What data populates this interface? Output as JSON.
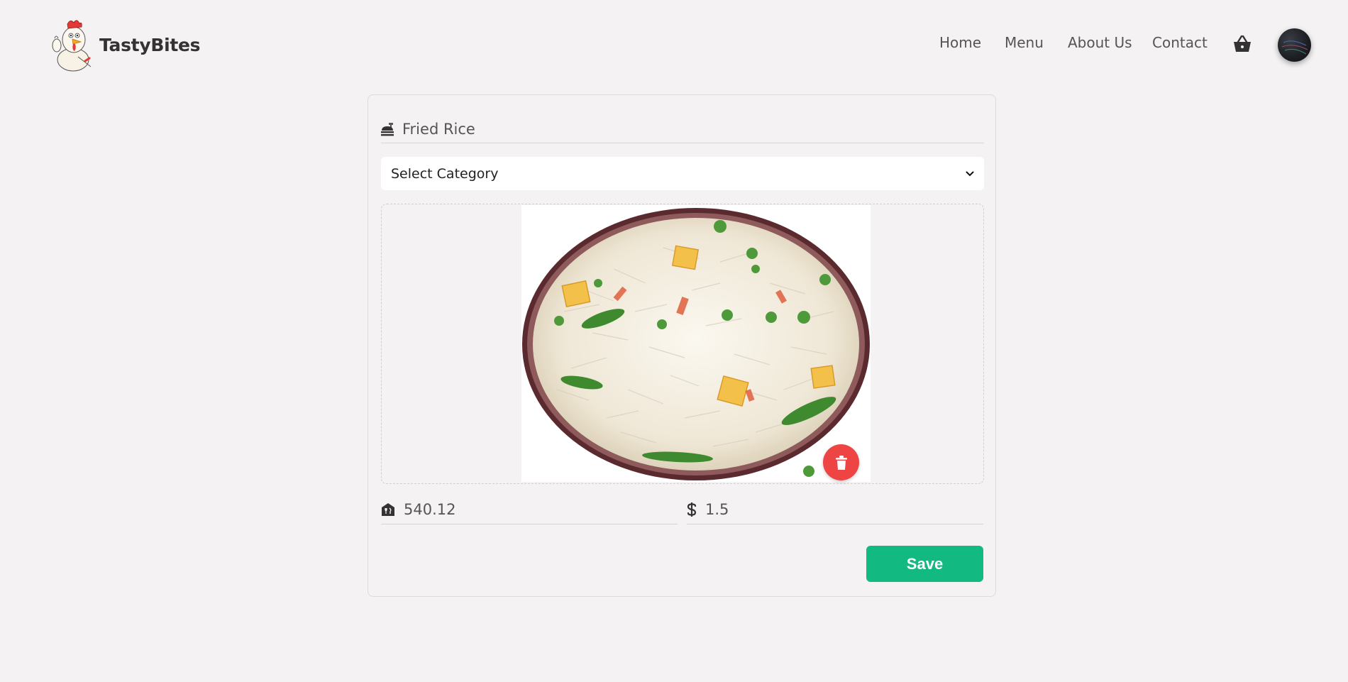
{
  "brand": {
    "name": "TastyBites"
  },
  "nav": {
    "home": "Home",
    "menu": "Menu",
    "about": "About Us",
    "contact": "Contact"
  },
  "form": {
    "title_value": "Fried Rice",
    "category_selected": "Select Category",
    "calories_value": "540.12",
    "price_value": "1.5",
    "save_label": "Save"
  },
  "icons": {
    "logo": "chicken-mascot-logo",
    "cart": "basket-icon",
    "title": "food-icon",
    "dropdown": "chevron-down-icon",
    "delete": "trash-icon",
    "calories": "food-bank-icon",
    "price": "dollar-icon"
  },
  "colors": {
    "save": "#12b981",
    "delete": "#ef4444",
    "background": "#f4f2f2"
  }
}
